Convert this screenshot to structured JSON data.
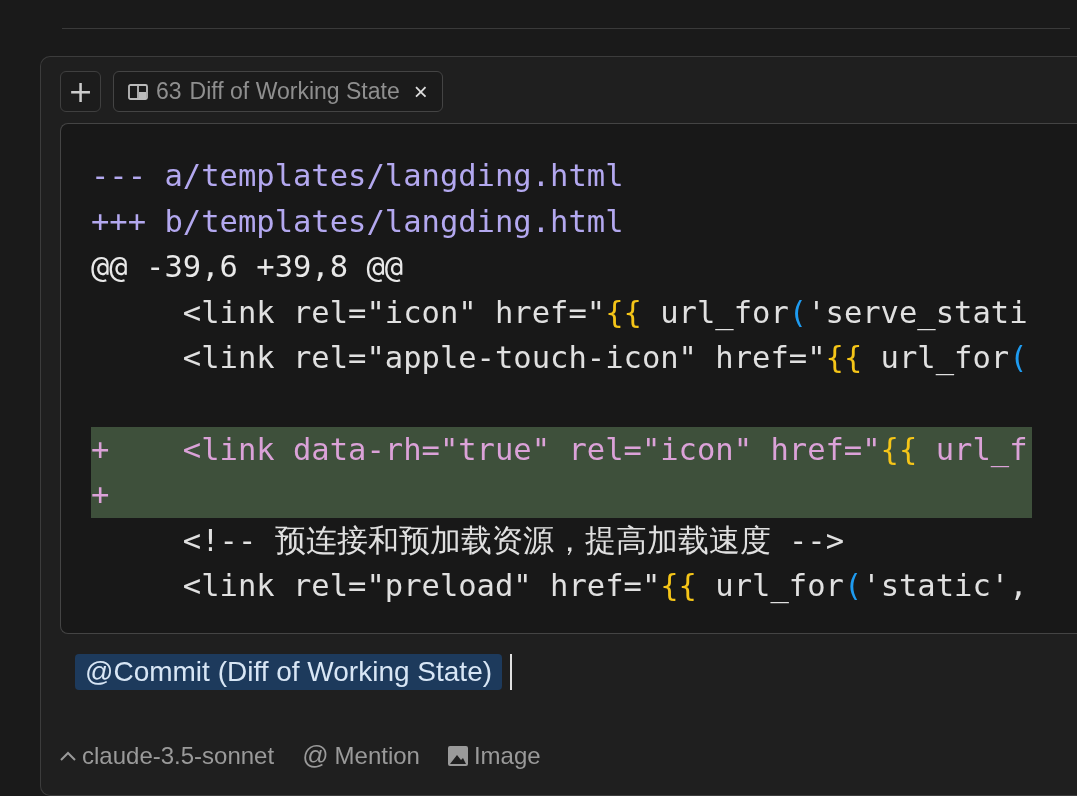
{
  "tabs_bar": {
    "add_button": "+",
    "tabs": [
      {
        "number": "63",
        "label": "Diff of Working State",
        "close": "×",
        "selected": true
      }
    ]
  },
  "diff": {
    "lines": [
      {
        "kind": "header",
        "segments": [
          {
            "text": "--- a/templates/langding.html",
            "color": "#b3a8ef"
          }
        ]
      },
      {
        "kind": "header",
        "segments": [
          {
            "text": "+++ b/templates/langding.html",
            "color": "#b3a8ef"
          }
        ]
      },
      {
        "kind": "hunk",
        "segments": [
          {
            "text": "@@ -39,6 +39,8 @@",
            "color": "#e8e8e8"
          }
        ]
      },
      {
        "kind": "context",
        "segments": [
          {
            "text": "     <link rel=\"icon\" href=\"",
            "color": "#e0e0e0"
          },
          {
            "text": "{{",
            "color": "#f5c518"
          },
          {
            "text": " url_for",
            "color": "#e0e0e0"
          },
          {
            "text": "(",
            "color": "#1e9bf0"
          },
          {
            "text": "'serve_stati",
            "color": "#e0e0e0"
          }
        ]
      },
      {
        "kind": "context",
        "segments": [
          {
            "text": "     <link rel=\"apple-touch-icon\" href=\"",
            "color": "#e0e0e0"
          },
          {
            "text": "{{",
            "color": "#f5c518"
          },
          {
            "text": " url_for",
            "color": "#e0e0e0"
          },
          {
            "text": "(",
            "color": "#1e9bf0"
          }
        ]
      },
      {
        "kind": "context"
      },
      {
        "kind": "added",
        "segments": [
          {
            "text": "+    <link data-rh=\"true\" rel=\"icon\" href=\"",
            "color": "#dba2d8"
          },
          {
            "text": "{{",
            "color": "#f5c518"
          },
          {
            "text": " url_f",
            "color": "#dba2d8"
          }
        ]
      },
      {
        "kind": "added",
        "segments": [
          {
            "text": "+",
            "color": "#dba2d8"
          }
        ]
      },
      {
        "kind": "context",
        "segments": [
          {
            "text": "     <!-- 预连接和预加载资源，提高加载速度 -->",
            "color": "#e0e0e0"
          }
        ]
      },
      {
        "kind": "context",
        "segments": [
          {
            "text": "     <link rel=\"preload\" href=\"",
            "color": "#e0e0e0"
          },
          {
            "text": "{{",
            "color": "#f5c518"
          },
          {
            "text": " url_for",
            "color": "#e0e0e0"
          },
          {
            "text": "(",
            "color": "#1e9bf0"
          },
          {
            "text": "'static',",
            "color": "#e0e0e0"
          }
        ]
      }
    ]
  },
  "input": {
    "mention": "@Commit (Diff of Working State)"
  },
  "toolbar": {
    "model": "claude-3.5-sonnet",
    "mention_icon": "@",
    "mention": "Mention",
    "image": "Image"
  }
}
